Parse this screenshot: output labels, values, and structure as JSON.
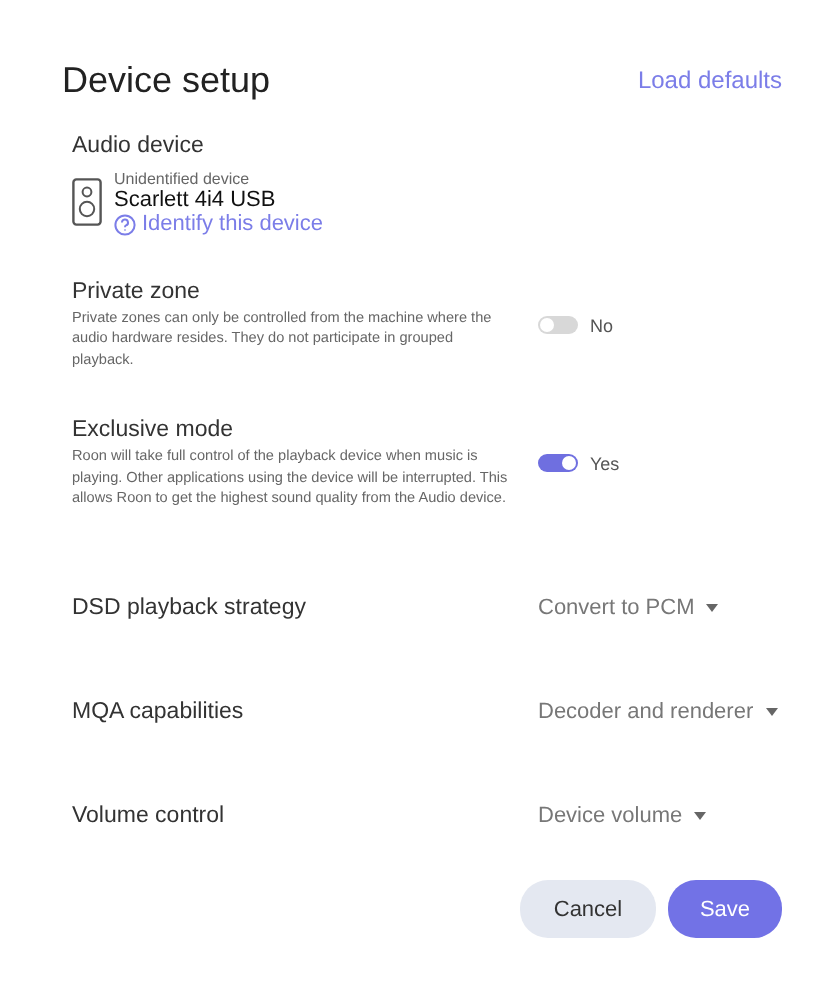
{
  "title": "Device setup",
  "load_defaults": "Load defaults",
  "audio_device": {
    "label": "Audio device",
    "status": "Unidentified device",
    "name": "Scarlett 4i4 USB",
    "identify_link": "Identify this device"
  },
  "settings": [
    {
      "kind": "toggle",
      "label": "Private zone",
      "description": "Private zones can only be controlled from the machine where the audio hardware resides. They do not participate in grouped playback.",
      "on": false,
      "value": "No"
    },
    {
      "kind": "toggle",
      "label": "Exclusive mode",
      "description": "Roon will take full control of the playback device when music is playing. Other applications using the device will be interrupted. This allows Roon to get the highest sound quality from the Audio device.",
      "on": true,
      "value": "Yes"
    },
    {
      "kind": "dropdown",
      "label": "DSD playback strategy",
      "value": "Convert to PCM"
    },
    {
      "kind": "dropdown",
      "label": "MQA capabilities",
      "value": "Decoder and renderer"
    },
    {
      "kind": "dropdown",
      "label": "Volume control",
      "value": "Device volume"
    }
  ],
  "buttons": [
    {
      "kind": "secondary",
      "label": "Cancel"
    },
    {
      "kind": "primary",
      "label": "Save"
    }
  ]
}
